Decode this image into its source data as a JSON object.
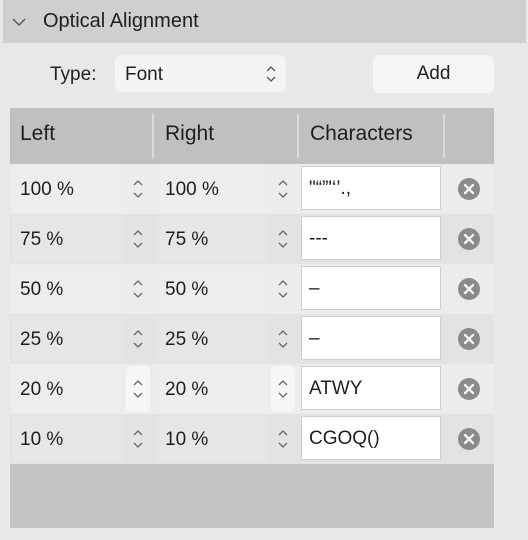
{
  "panel": {
    "title": "Optical Alignment"
  },
  "type_row": {
    "label": "Type:",
    "value": "Font",
    "add_label": "Add"
  },
  "table": {
    "headers": {
      "left": "Left",
      "right": "Right",
      "characters": "Characters"
    },
    "rows": [
      {
        "left": "100 %",
        "right": "100 %",
        "characters": "\"“”'‘’.,"
      },
      {
        "left": "75 %",
        "right": "75 %",
        "characters": "---"
      },
      {
        "left": "50 %",
        "right": "50 %",
        "characters": "–"
      },
      {
        "left": "25 %",
        "right": "25 %",
        "characters": "–"
      },
      {
        "left": "20 %",
        "right": "20 %",
        "characters": "ATWY"
      },
      {
        "left": "10 %",
        "right": "10 %",
        "characters": "CGOQ()"
      }
    ]
  },
  "icons": {
    "collapse": "chevron-down-icon",
    "stepper": "up-down-chevron-icon",
    "delete": "circle-x-icon"
  }
}
